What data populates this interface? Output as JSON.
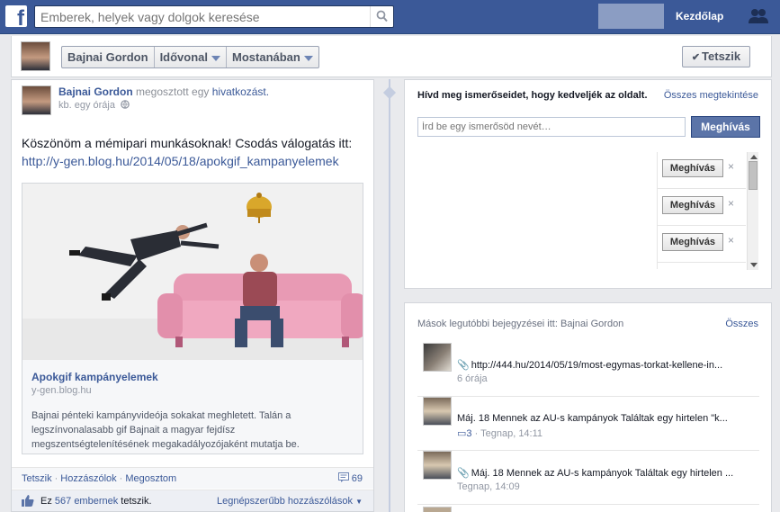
{
  "topbar": {
    "logo_letter": "f",
    "search_placeholder": "Emberek, helyek vagy dolgok keresése",
    "home_link": "Kezdőlap",
    "icons": {
      "search": "search-icon",
      "friends": "friends-icon"
    },
    "brand_color": "#3b5998"
  },
  "timeline_header": {
    "name": "Bajnai Gordon",
    "tab_timeline": "Idővonal",
    "tab_recent": "Mostanában",
    "like_button": "Tetszik"
  },
  "post": {
    "author": "Bajnai Gordon",
    "action_text": "megosztott egy",
    "action_link": "hivatkozást.",
    "time": "kb. egy órája",
    "body_text": "Köszönöm a mémipari munkásoknak! Csodás válogatás itt:",
    "body_link": "http://y-gen.blog.hu/2014/05/18/apokgif_kampanyelemek",
    "card": {
      "title": "Apokgif kampányelemek",
      "domain": "y-gen.blog.hu",
      "description": "Bajnai pénteki kampányvideója sokakat meghletett. Talán a legszínvonalasabb gif Bajnait a magyar fejdísz megszentségtelenítésének megakadályozójaként mutatja be."
    },
    "actions": {
      "like": "Tetszik",
      "comment": "Hozzászólok",
      "share": "Megosztom",
      "comment_count": "69"
    },
    "likes": {
      "prefix": "Ez",
      "count": "567 embernek",
      "suffix": "tetszik.",
      "top_comments": "Legnépszerűbb hozzászólások"
    }
  },
  "invite": {
    "title": "Hívd meg ismerőseidet, hogy kedveljék az oldalt.",
    "see_all": "Összes megtekintése",
    "input_placeholder": "Írd be egy ismerősöd nevét…",
    "invite_button": "Meghívás",
    "rows": [
      {
        "button": "Meghívás",
        "close": "×"
      },
      {
        "button": "Meghívás",
        "close": "×"
      },
      {
        "button": "Meghívás",
        "close": "×"
      }
    ]
  },
  "recent": {
    "title": "Mások legutóbbi bejegyzései itt: Bajnai Gordon",
    "see_all": "Összes",
    "items": [
      {
        "text": "http://444.hu/2014/05/19/most-egymas-torkat-kellene-in...",
        "time": "6 órája",
        "comments": ""
      },
      {
        "text": "Máj. 18 Mennek az AU-s kampányok Találtak egy hirtelen \"k...",
        "time": "· Tegnap, 14:11",
        "comments": "3"
      },
      {
        "text": "Máj. 18 Mennek az AU-s kampányok Találtak egy hirtelen ...",
        "time": "Tegnap, 14:09",
        "comments": ""
      }
    ]
  }
}
